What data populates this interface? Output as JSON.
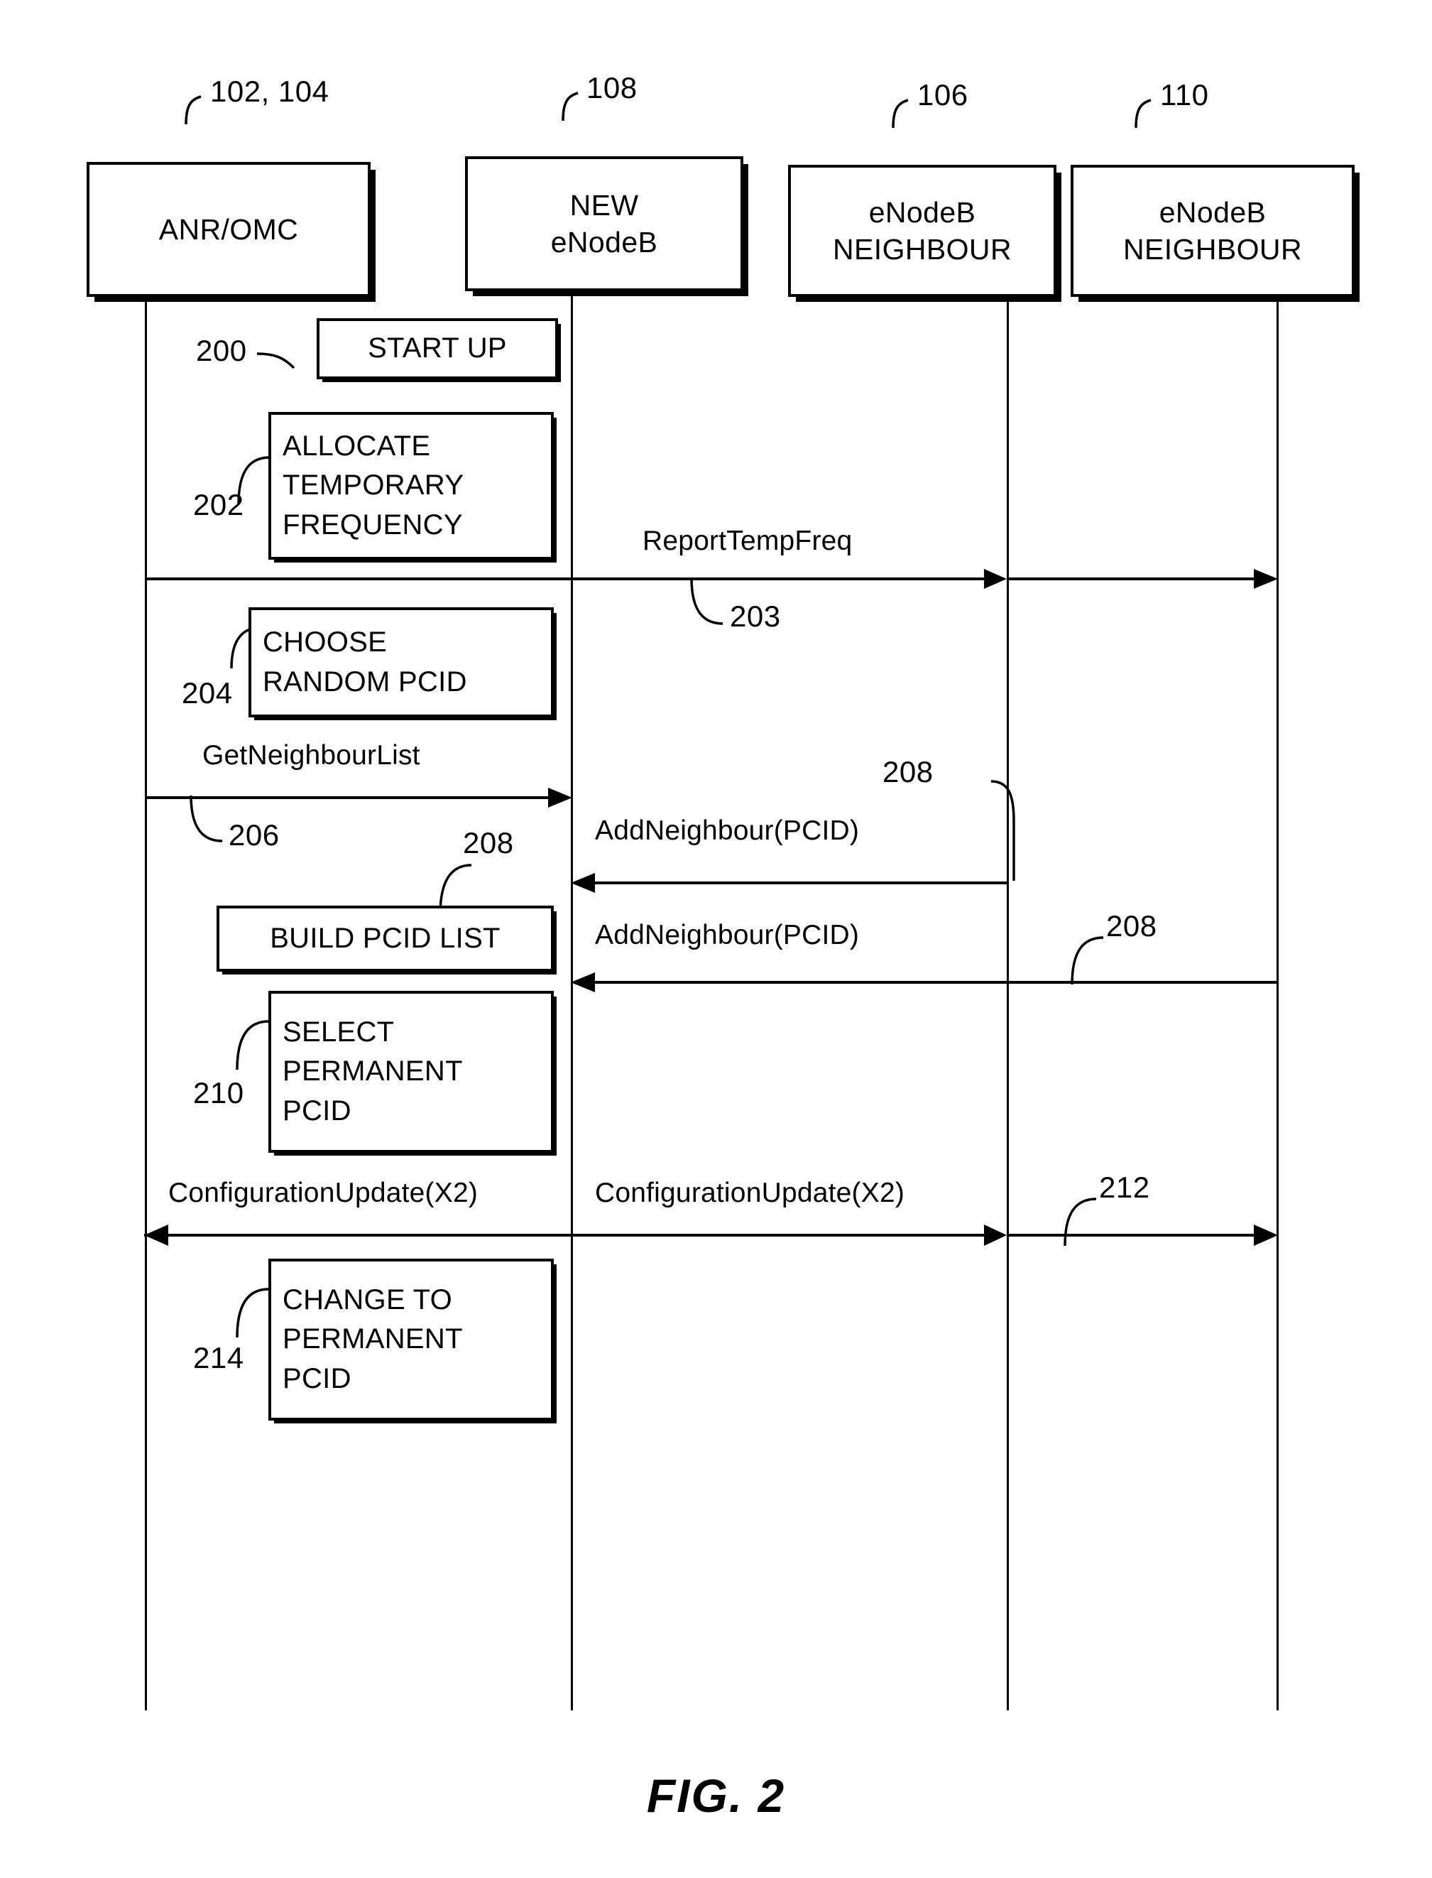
{
  "figure": {
    "caption": "FIG. 2",
    "type": "sequence-diagram"
  },
  "participants": [
    {
      "ref": "102, 104",
      "line1": "ANR/OMC",
      "line2": ""
    },
    {
      "ref": "108",
      "line1": "NEW",
      "line2": "eNodeB"
    },
    {
      "ref": "106",
      "line1": "eNodeB",
      "line2": "NEIGHBOUR"
    },
    {
      "ref": "110",
      "line1": "eNodeB",
      "line2": "NEIGHBOUR"
    }
  ],
  "activities": [
    {
      "ref": "200",
      "lines": [
        "START UP"
      ]
    },
    {
      "ref": "202",
      "lines": [
        "ALLOCATE",
        "TEMPORARY",
        "FREQUENCY"
      ]
    },
    {
      "ref": "204",
      "lines": [
        "CHOOSE",
        "RANDOM PCID"
      ]
    },
    {
      "ref": "208",
      "lines": [
        "BUILD PCID LIST"
      ]
    },
    {
      "ref": "210",
      "lines": [
        "SELECT",
        "PERMANENT",
        "PCID"
      ]
    },
    {
      "ref": "214",
      "lines": [
        "CHANGE TO",
        "PERMANENT",
        "PCID"
      ]
    }
  ],
  "messages": [
    {
      "ref": "203",
      "label": "ReportTempFreq",
      "from": "ANR/OMC",
      "to": "eNodeB NEIGHBOUR 110",
      "direction": "right"
    },
    {
      "ref": "206",
      "label": "GetNeighbourList",
      "from": "ANR/OMC",
      "to": "NEW eNodeB",
      "direction": "right"
    },
    {
      "ref": "208",
      "label": "AddNeighbour(PCID)",
      "from": "eNodeB NEIGHBOUR 106",
      "to": "NEW eNodeB",
      "direction": "left"
    },
    {
      "ref": "208",
      "label": "AddNeighbour(PCID)",
      "from": "eNodeB NEIGHBOUR 110",
      "to": "NEW eNodeB",
      "direction": "left"
    },
    {
      "ref": "212",
      "label": "ConfigurationUpdate(X2)",
      "from": "ANR/OMC",
      "to": "eNodeB NEIGHBOUR 110",
      "direction": "both"
    },
    {
      "ref": "212",
      "label": "ConfigurationUpdate(X2)",
      "from": "NEW eNodeB",
      "to": "eNodeB NEIGHBOUR 110",
      "direction": "both"
    }
  ],
  "refs": {
    "r102_104": "102, 104",
    "r108": "108",
    "r106": "106",
    "r110": "110",
    "r200": "200",
    "r202": "202",
    "r203": "203",
    "r204": "204",
    "r206": "206",
    "r208a": "208",
    "r208b": "208",
    "r208c": "208",
    "r210": "210",
    "r212": "212",
    "r214": "214"
  },
  "labels": {
    "reportTempFreq": "ReportTempFreq",
    "getNeighbourList": "GetNeighbourList",
    "addNeighbour1": "AddNeighbour(PCID)",
    "addNeighbour2": "AddNeighbour(PCID)",
    "configUpdateLeft": "ConfigurationUpdate(X2)",
    "configUpdateRight": "ConfigurationUpdate(X2)"
  },
  "boxText": {
    "p1l1": "ANR/OMC",
    "p2l1": "NEW",
    "p2l2": "eNodeB",
    "p3l1": "eNodeB",
    "p3l2": "NEIGHBOUR",
    "p4l1": "eNodeB",
    "p4l2": "NEIGHBOUR",
    "a200l1": "START UP",
    "a202l1": "ALLOCATE",
    "a202l2": "TEMPORARY",
    "a202l3": "FREQUENCY",
    "a204l1": "CHOOSE",
    "a204l2": "RANDOM PCID",
    "a208l1": "BUILD PCID LIST",
    "a210l1": "SELECT",
    "a210l2": "PERMANENT",
    "a210l3": "PCID",
    "a214l1": "CHANGE TO",
    "a214l2": "PERMANENT",
    "a214l3": "PCID"
  },
  "colors": {
    "ink": "#000000",
    "paper": "#ffffff"
  }
}
